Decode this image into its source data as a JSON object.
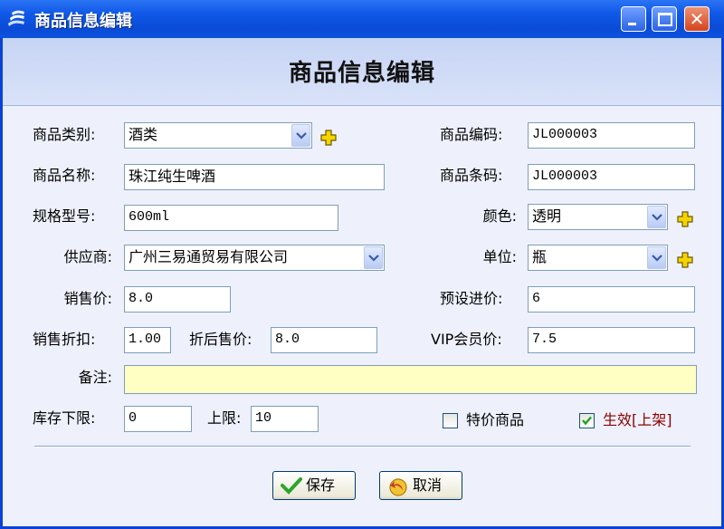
{
  "window": {
    "title": "商品信息编辑",
    "close_glyph": "✕"
  },
  "form": {
    "heading": "商品信息编辑",
    "category": {
      "label": "商品类别:",
      "value": "酒类"
    },
    "code": {
      "label": "商品编码:",
      "value": "JL000003"
    },
    "name": {
      "label": "商品名称:",
      "value": "珠江纯生啤酒"
    },
    "barcode": {
      "label": "商品条码:",
      "value": "JL000003"
    },
    "spec": {
      "label": "规格型号:",
      "value": "600ml"
    },
    "color": {
      "label": "颜色:",
      "value": "透明"
    },
    "supplier": {
      "label": "供应商:",
      "value": "广州三易通贸易有限公司"
    },
    "unit": {
      "label": "单位:",
      "value": "瓶"
    },
    "sale_price": {
      "label": "销售价:",
      "value": "8.0"
    },
    "preset_cost": {
      "label": "预设进价:",
      "value": "6"
    },
    "discount": {
      "label": "销售折扣:",
      "value": "1.00"
    },
    "discount_price": {
      "label": "折后售价:",
      "value": "8.0"
    },
    "vip_price": {
      "label": "VIP会员价:",
      "value": "7.5"
    },
    "remark": {
      "label": "备注:",
      "value": ""
    },
    "stock_min": {
      "label": "库存下限:",
      "value": "0"
    },
    "stock_max": {
      "label": "上限:",
      "value": "10"
    },
    "special": {
      "label": "特价商品",
      "checked": false
    },
    "active": {
      "label": "生效[上架]",
      "checked": true,
      "color": "#8b0000"
    }
  },
  "buttons": {
    "save": "保存",
    "cancel": "取消"
  },
  "icons": [
    "app-icon",
    "dropdown-arrow-icon",
    "add-plus-icon",
    "checkmark-icon",
    "cancel-arrow-icon"
  ]
}
